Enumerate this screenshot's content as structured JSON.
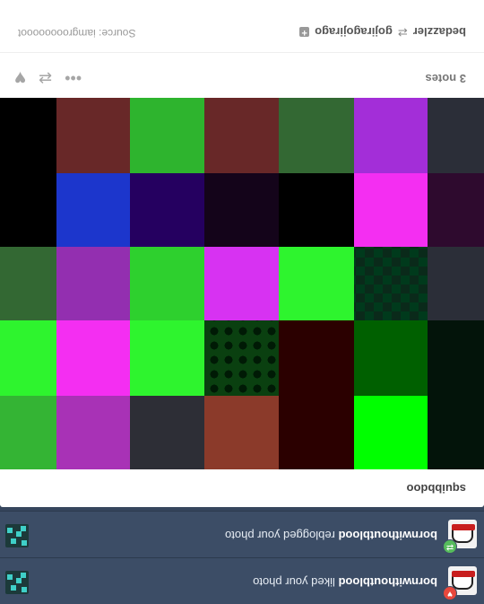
{
  "activity": [
    {
      "user": "bornwithoutblood",
      "action": "liked your photo",
      "badge": "like"
    },
    {
      "user": "bornwithoutblood",
      "action": "reblogged your photo",
      "badge": "reblog"
    }
  ],
  "post": {
    "author": "squibbdoo",
    "notes": "3 notes",
    "reblog_from": "bedazzler",
    "reblog_to": "gojiragojirago",
    "source_label": "Source:",
    "source_name": "iamgroooooooot"
  },
  "icons": {
    "more": "more-dots-icon",
    "reblog": "reblog-icon",
    "heart": "heart-icon",
    "like_badge": "heart-icon",
    "reblog_badge": "reblog-icon"
  },
  "grid_colors": [
    [
      "#03140a",
      "#00ff00",
      "#2b0000",
      "#8b3a2a",
      "#2d2e36",
      "#a832b6",
      "#34b434"
    ],
    [
      "#03140a",
      "#006000",
      "#2b0000",
      "dots",
      "#2ef42e",
      "#f42ef2",
      "#2ef42e"
    ],
    [
      "#2b2e38",
      "checker",
      "#2ef42e",
      "#d732f2",
      "#2ed02e",
      "#932fb0",
      "#336833"
    ],
    [
      "#2e0a2e",
      "#f42ef2",
      "#000000",
      "#14041a",
      "#250060",
      "#1c36cc",
      "#000000"
    ],
    [
      "#2b2e38",
      "#a32ed8",
      "#336833",
      "#682828",
      "#2eb42e",
      "#682828",
      "#000000"
    ]
  ]
}
